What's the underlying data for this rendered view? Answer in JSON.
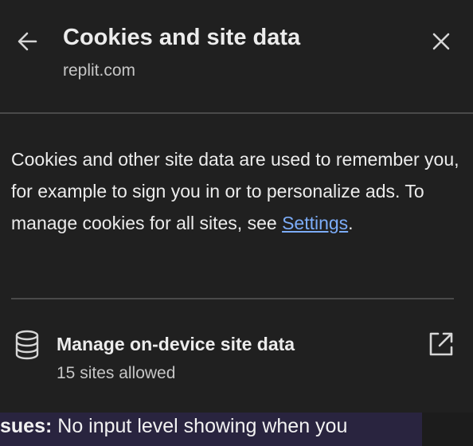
{
  "header": {
    "title": "Cookies and site data",
    "subtitle": "replit.com",
    "back_icon": "arrow-left-icon",
    "close_icon": "close-icon"
  },
  "description": {
    "text_before_link": "Cookies and other site data are used to remember you, for example to sign you in or to personalize ads. To manage cookies for all sites, see ",
    "link_label": "Settings",
    "text_after_link": "."
  },
  "manage_row": {
    "title": "Manage on-device site data",
    "subtitle": "15 sites allowed",
    "icon": "database-icon",
    "action_icon": "open-external-icon"
  },
  "background_page": {
    "label": "sues:",
    "text": " No input level showing when you"
  },
  "colors": {
    "panel_bg": "#202020",
    "link": "#7cacf8",
    "divider": "#4a4a4a",
    "background_card": "#29243f"
  }
}
